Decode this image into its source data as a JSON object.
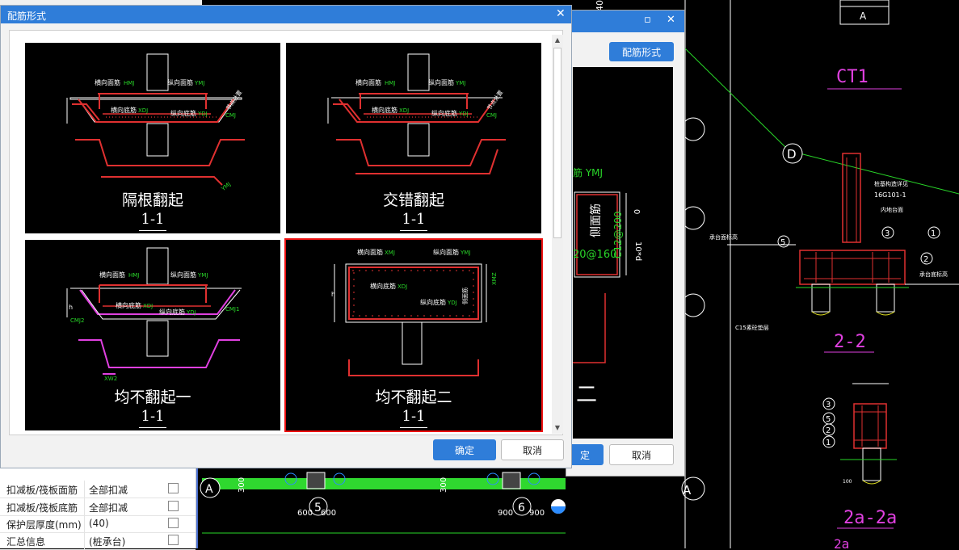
{
  "dialog": {
    "title": "配筋形式",
    "ok_label": "确定",
    "cancel_label": "取消",
    "options": [
      {
        "name": "隔根翻起",
        "section": "1-1",
        "selected": false
      },
      {
        "name": "交错翻起",
        "section": "1-1",
        "selected": false
      },
      {
        "name": "均不翻起一",
        "section": "1-1",
        "selected": false
      },
      {
        "name": "均不翻起二",
        "section": "1-1",
        "selected": true
      }
    ],
    "labels": {
      "top_h": "横向面筋",
      "top_h_code": "HMJ",
      "top_v": "纵向面筋",
      "top_v_code": "YMJ",
      "bot_h": "横向底筋",
      "bot_h_code": "XDJ",
      "bot_v": "纵向底筋",
      "bot_v_code": "YDJ",
      "side": "侧面筋",
      "cmj": "CMJ",
      "cmj1": "CMJ1",
      "cmj2": "CMJ2",
      "xmj": "XMJ",
      "ymj": "YMJ",
      "xmz": "XMZ",
      "xw2": "XW2",
      "h": "h",
      "stirrup": "节点处置"
    }
  },
  "bg_dialog": {
    "rebar_button": "配筋形式",
    "ok_label": "定",
    "cancel_label": "取消",
    "preview": {
      "ymj_text": "筋 YMJ",
      "side_text": "侧面筋",
      "spacing1": "C12@200",
      "spacing2": "20@160",
      "dim1": "0",
      "dim2": "10*d",
      "glyph": "二"
    }
  },
  "properties": {
    "rows": [
      {
        "key": "扣减板/筏板面筋",
        "value": "全部扣减",
        "checked": false
      },
      {
        "key": "扣减板/筏板底筋",
        "value": "全部扣减",
        "checked": false
      },
      {
        "key": "保护层厚度(mm)",
        "value": "(40)",
        "checked": false
      },
      {
        "key": "汇总信息",
        "value": "(桩承台)",
        "checked": false
      }
    ]
  },
  "cad": {
    "label_ct1": "CT1",
    "label_22": "2-2",
    "label_2a": "2a-2a",
    "label_2a_partial": "2a",
    "axis_d": "D",
    "axis_a": "A",
    "axis_a_top": "A",
    "axis_5": "5",
    "axis_6": "6",
    "dim_600a": "600",
    "dim_600b": "600",
    "dim_900a": "900",
    "dim_900b": "900",
    "dim_300a": "300",
    "dim_300b": "300",
    "note_std": "16G101-1",
    "note_pile": "桩基构造详见",
    "note_ground": "内地台面",
    "note_top": "承台面标高",
    "note_bottom": "承台底标高",
    "note_c15": "C15素砼垫层",
    "note_100": "100",
    "callout_1": "1",
    "callout_2": "2",
    "callout_3": "3",
    "callout_5": "5",
    "digit_40": "40"
  }
}
